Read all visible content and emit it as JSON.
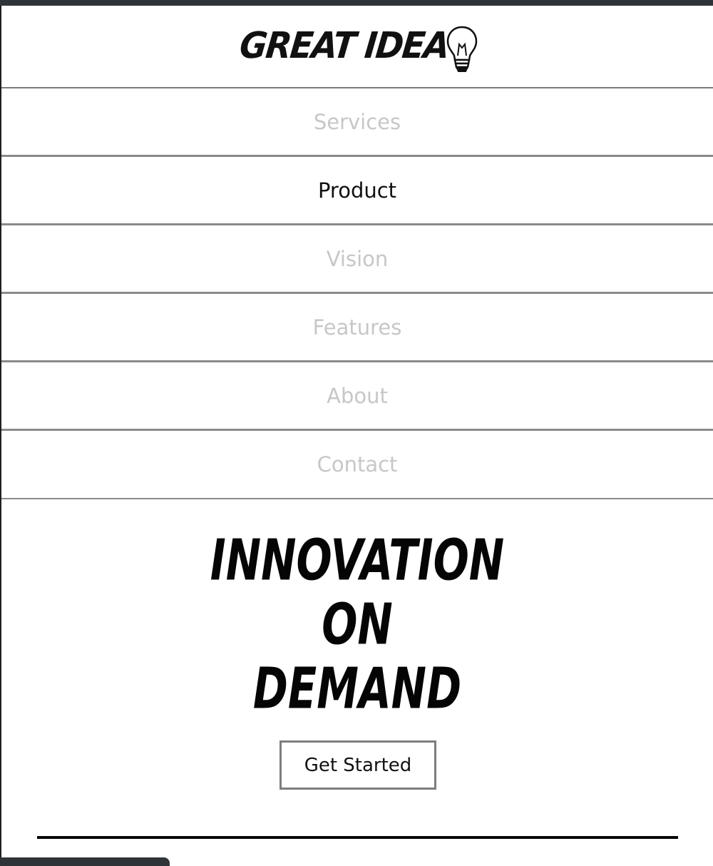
{
  "brand": {
    "logo_text": "GREAT IDEA",
    "logo_icon": "lightbulb-icon"
  },
  "nav": {
    "items": [
      {
        "label": "Services",
        "active": false
      },
      {
        "label": "Product",
        "active": true
      },
      {
        "label": "Vision",
        "active": false
      },
      {
        "label": "Features",
        "active": false
      },
      {
        "label": "About",
        "active": false
      },
      {
        "label": "Contact",
        "active": false
      }
    ]
  },
  "hero": {
    "lines": [
      "INNOVATION",
      "ON",
      "DEMAND"
    ]
  },
  "cta": {
    "label": "Get Started"
  },
  "colors": {
    "nav_inactive": "#c7c7c7",
    "nav_active": "#111111",
    "divider": "#8a8a8a",
    "top_strip": "#2f3439"
  }
}
